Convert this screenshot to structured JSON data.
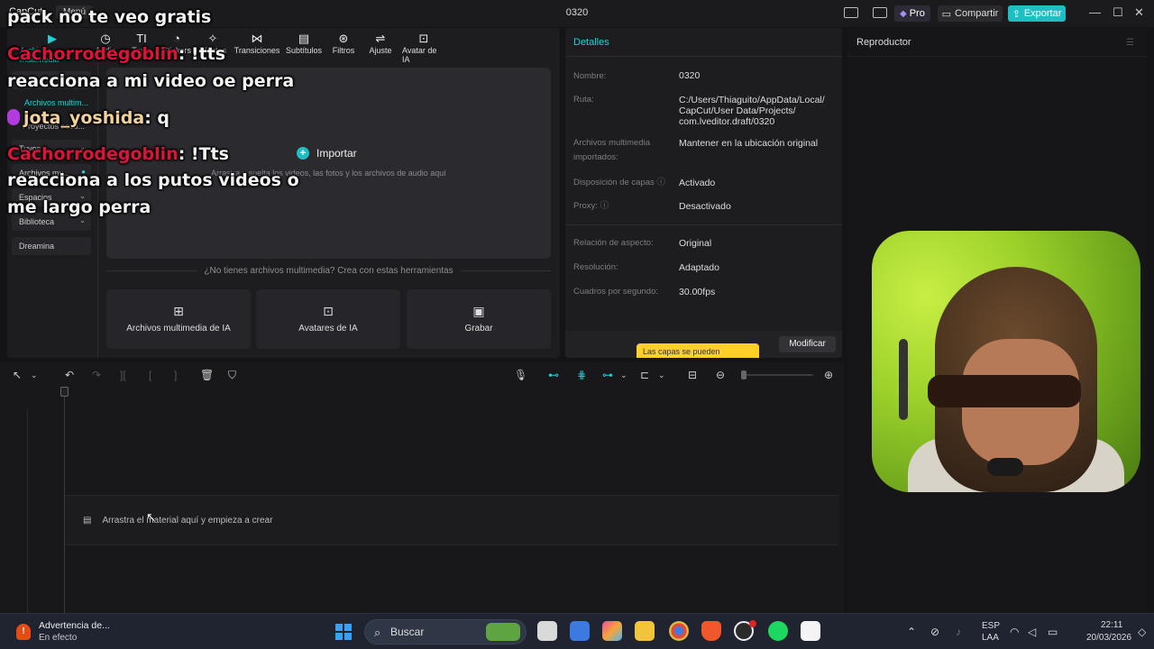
{
  "titlebar": {
    "app_logo": "CapCut",
    "menu_label": "Menú",
    "project_title": "0320",
    "pro_label": "Pro",
    "share_label": "Compartir",
    "export_label": "Exportar"
  },
  "tool_tabs": [
    {
      "label": "Archivos multimedia",
      "icon": "media-icon"
    },
    {
      "label": "Audio",
      "icon": "audio-icon"
    },
    {
      "label": "Texto",
      "icon": "text-icon"
    },
    {
      "label": "Stickers",
      "icon": "sticker-icon"
    },
    {
      "label": "Efectos",
      "icon": "effects-icon"
    },
    {
      "label": "Transiciones",
      "icon": "transition-icon"
    },
    {
      "label": "Subtítulos",
      "icon": "subtitle-icon"
    },
    {
      "label": "Filtros",
      "icon": "filter-icon"
    },
    {
      "label": "Ajuste",
      "icon": "adjust-icon"
    },
    {
      "label": "Avatar de IA",
      "icon": "avatar-icon"
    }
  ],
  "side_nav": {
    "sub_active": "Archivos multim...",
    "sub_projects": "Proyectos secu...",
    "items": [
      {
        "label": "Tuyos"
      },
      {
        "label": "Archivos mu..."
      },
      {
        "label": "Espacios"
      },
      {
        "label": "Biblioteca"
      },
      {
        "label": "Dreamina"
      }
    ]
  },
  "media": {
    "import_label": "Importar",
    "drop_hint": "Arrastra y suelta los videos, las fotos y los archivos de audio aquí",
    "no_media_text": "¿No tienes archivos multimedia? Crea con estas herramientas",
    "cards": [
      {
        "label": "Archivos multimedia de IA"
      },
      {
        "label": "Avatares de IA"
      },
      {
        "label": "Grabar"
      }
    ]
  },
  "details": {
    "header": "Detalles",
    "rows": [
      {
        "label": "Nombre:",
        "value": "0320"
      },
      {
        "label": "Ruta:",
        "value": "C:/Users/Thiaguito/AppData/Local/ CapCut/User Data/Projects/ com.lveditor.draft/0320"
      },
      {
        "label": "Archivos multimedia importados:",
        "value": "Mantener en la ubicación original"
      },
      {
        "label": "Disposición de capas",
        "value": "Activado"
      },
      {
        "label": "Proxy:",
        "value": "Desactivado"
      },
      {
        "label": "Relación de aspecto:",
        "value": "Original"
      },
      {
        "label": "Resolución:",
        "value": "Adaptado"
      },
      {
        "label": "Cuadros por segundo:",
        "value": "30.00fps"
      }
    ],
    "tooltip": "Las capas se pueden",
    "modify_label": "Modificar"
  },
  "player": {
    "header": "Reproductor"
  },
  "timeline": {
    "track_hint": "Arrastra el material aquí y empieza a crear"
  },
  "chat": [
    {
      "user": "",
      "text": "pack no te veo gratis"
    },
    {
      "user": "Cachorrodegoblin",
      "text": "!tts"
    },
    {
      "user": "",
      "text": "reacciona a mi video oe perra"
    },
    {
      "user": "jota_yoshida",
      "text": "q"
    },
    {
      "user": "Cachorrodegoblin",
      "text": "!Tts"
    },
    {
      "user": "",
      "text": "reacciona a los putos videos o"
    },
    {
      "user": "",
      "text": "me largo perra"
    }
  ],
  "taskbar": {
    "notice_title": "Advertencia de...",
    "notice_sub": "En efecto",
    "search_label": "Buscar",
    "lang_top": "ESP",
    "lang_bottom": "LAA",
    "time": "22:11",
    "date": "20/03/2026"
  },
  "colors": {
    "accent": "#1dbfc3",
    "chat_user": "#e0123c",
    "webcam_bg": "#9cd22a"
  }
}
